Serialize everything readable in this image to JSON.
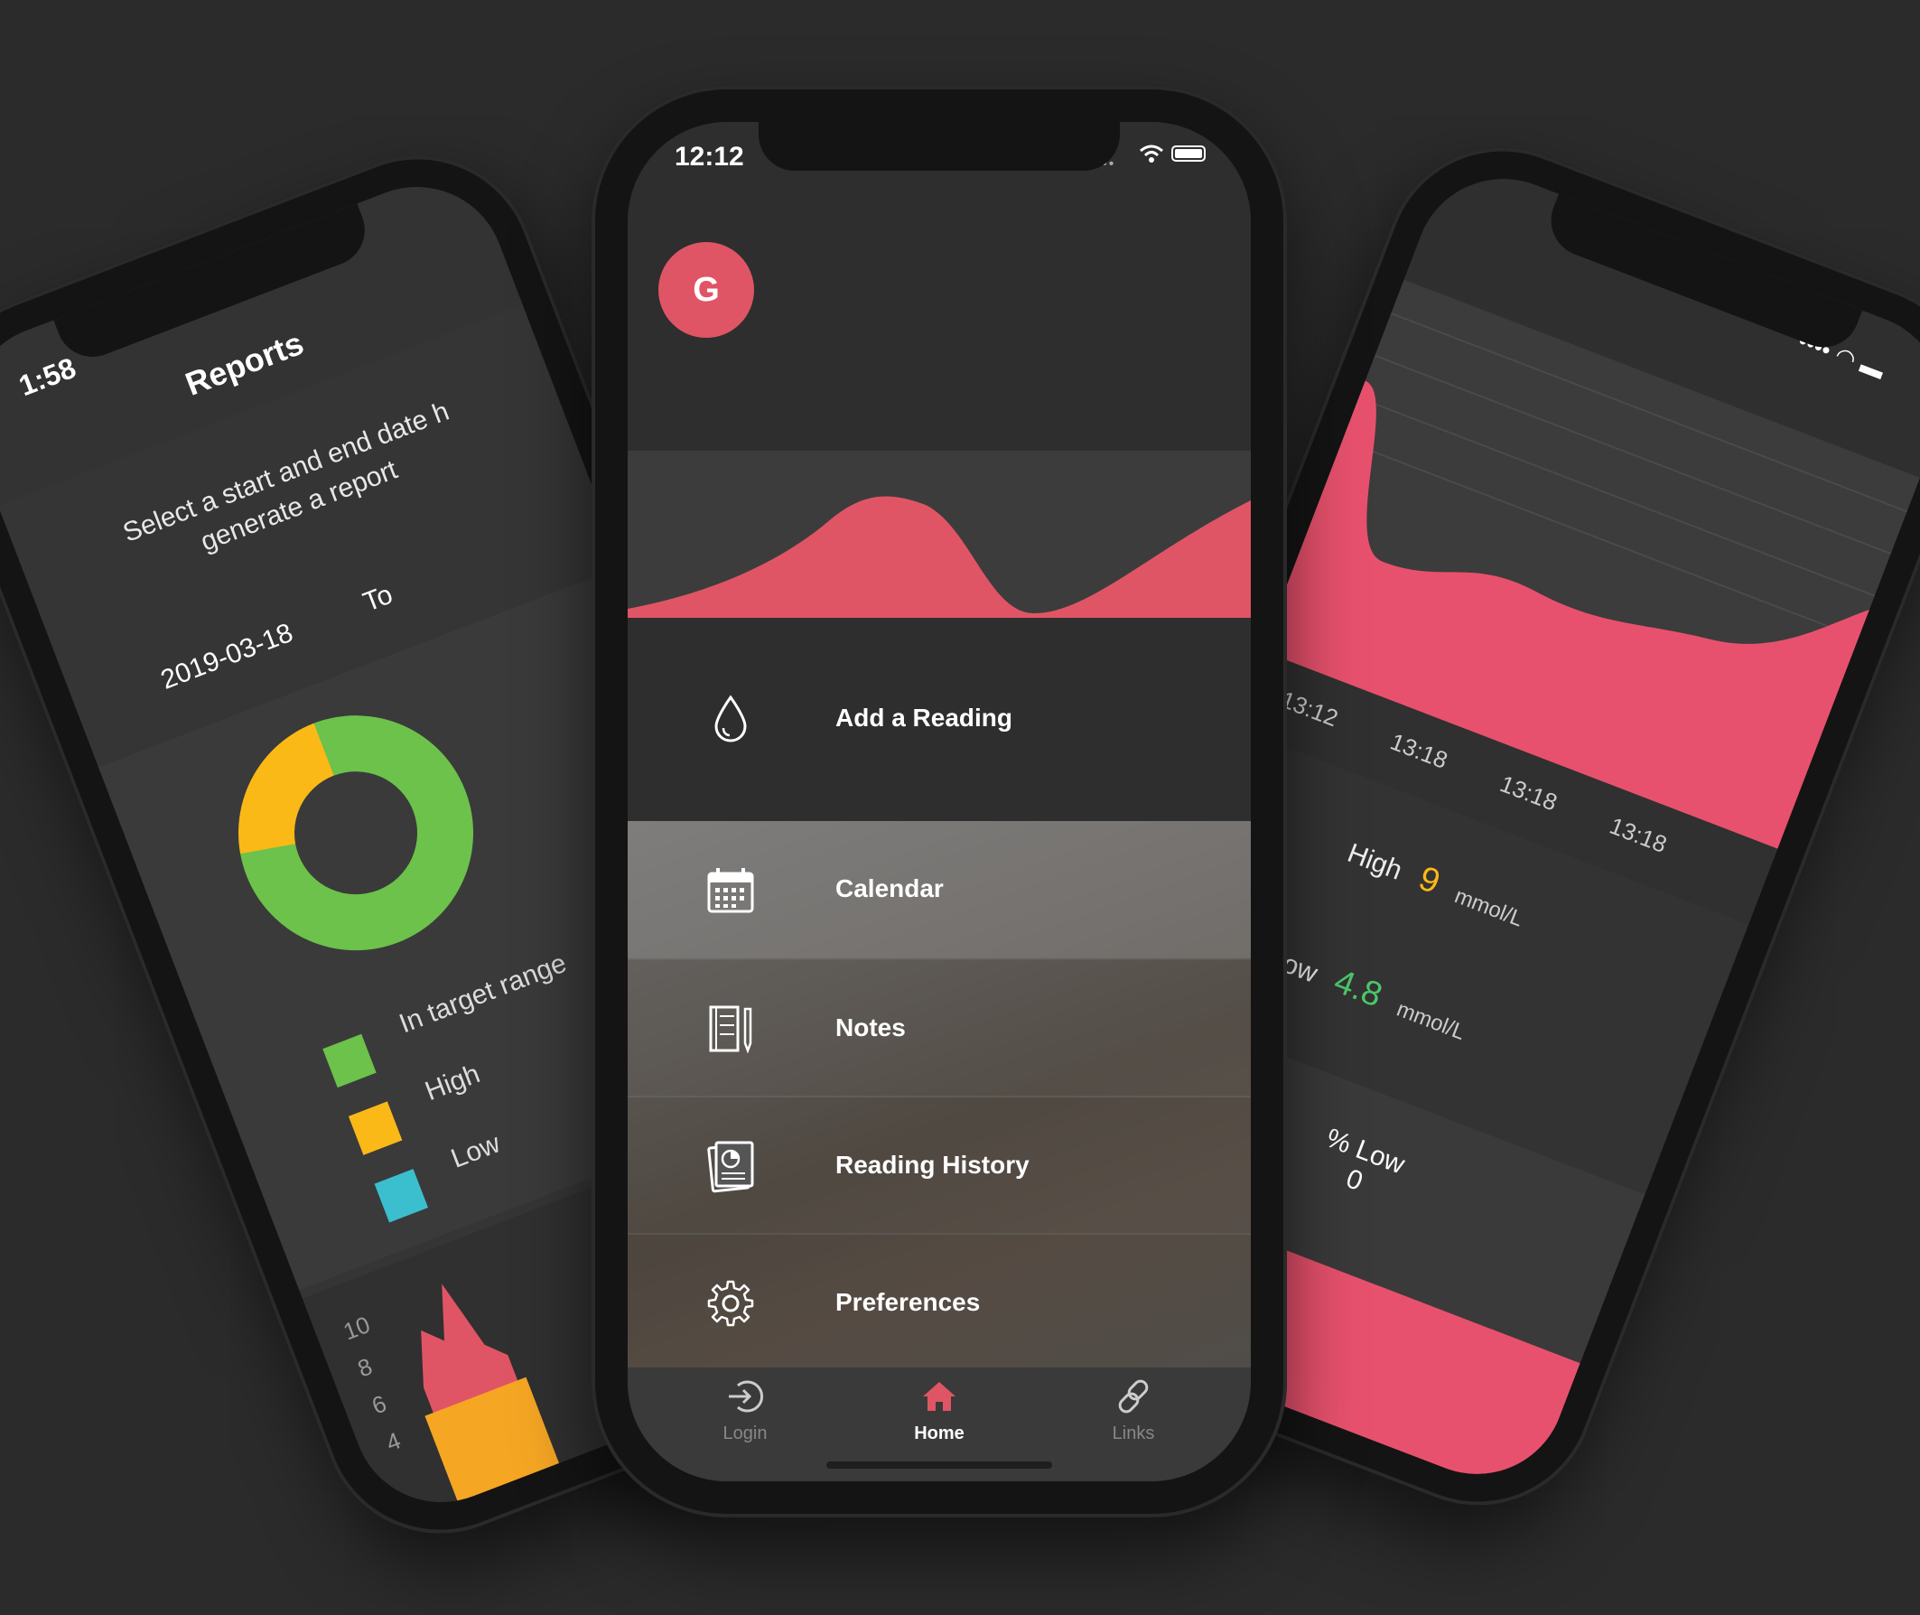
{
  "left_phone": {
    "time": "1:58",
    "title": "Reports",
    "subtitle": "Select a start and end date h generate a report",
    "date_from": "2019-03-18",
    "date_to_label": "To",
    "legend": [
      {
        "label": "In target range",
        "color": "#6cc24a"
      },
      {
        "label": "High",
        "color": "#fbb917"
      },
      {
        "label": "Low",
        "color": "#3bbfcf"
      }
    ],
    "y_ticks": [
      "10",
      "8",
      "6",
      "4"
    ],
    "donut": {
      "in_target_pct": 78,
      "high_pct": 22
    }
  },
  "center_phone": {
    "time": "12:12",
    "avatar_initial": "G",
    "accent_color": "#e05565",
    "menu": [
      {
        "label": "Add a Reading",
        "icon": "water-drop-icon"
      },
      {
        "label": "Calendar",
        "icon": "calendar-icon"
      },
      {
        "label": "Notes",
        "icon": "notes-icon"
      },
      {
        "label": "Reading History",
        "icon": "reading-history-icon"
      },
      {
        "label": "Preferences",
        "icon": "gear-icon"
      }
    ],
    "tabs": [
      {
        "label": "Login",
        "icon": "login-icon"
      },
      {
        "label": "Home",
        "icon": "home-icon",
        "active": true
      },
      {
        "label": "Links",
        "icon": "link-icon"
      }
    ]
  },
  "right_phone": {
    "times": [
      "13:12",
      "13:18",
      "13:18",
      "13:18"
    ],
    "high_label": "High",
    "high_value": "9",
    "high_unit": "mmol/L",
    "high_color": "#fbb917",
    "low_label": "Low",
    "low_value": "4.8",
    "low_unit": "mmol/L",
    "low_color": "#4cc76a",
    "pct_low_label": "% Low",
    "pct_low_value": "0"
  }
}
